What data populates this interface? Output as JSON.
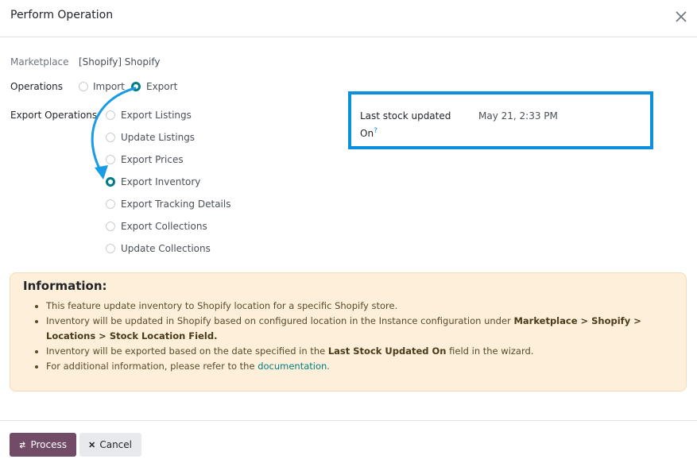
{
  "dialog": {
    "title": "Perform Operation"
  },
  "form": {
    "marketplace_label": "Marketplace",
    "marketplace_value": "[Shopify] Shopify",
    "operations_label": "Operations",
    "operations_options": [
      "Import",
      "Export"
    ],
    "operations_selected": "Export",
    "export_operations_label": "Export Operations",
    "export_operations_options": [
      "Export Listings",
      "Update Listings",
      "Export Prices",
      "Export Inventory",
      "Export Tracking Details",
      "Export Collections",
      "Update Collections"
    ],
    "export_operations_selected": "Export Inventory",
    "last_stock_label": "Last stock updated On",
    "last_stock_help": "?",
    "last_stock_value": "May 21, 2:33 PM"
  },
  "info": {
    "title": "Information:",
    "item1": "This feature update inventory to Shopify location for a specific Shopify store.",
    "item2_pre": "Inventory will be updated in Shopify based on configured location in the Instance configuration under ",
    "item2_bold": "Marketplace > Shopify > Locations > Stock Location Field.",
    "item3_pre": "Inventory will be exported based on the date specified in the ",
    "item3_bold": "Last Stock Updated On",
    "item3_post": " field in the wizard.",
    "item4_pre": "For additional information, please refer to the ",
    "item4_link": "documentation."
  },
  "footer": {
    "process_label": "Process",
    "cancel_label": "Cancel"
  },
  "colors": {
    "accent": "#017e84",
    "primary_button": "#714b67",
    "highlight": "#0d8fe0",
    "info_bg": "#fdefd9"
  },
  "icons": [
    "close-icon",
    "transfer-icon",
    "times-icon"
  ]
}
